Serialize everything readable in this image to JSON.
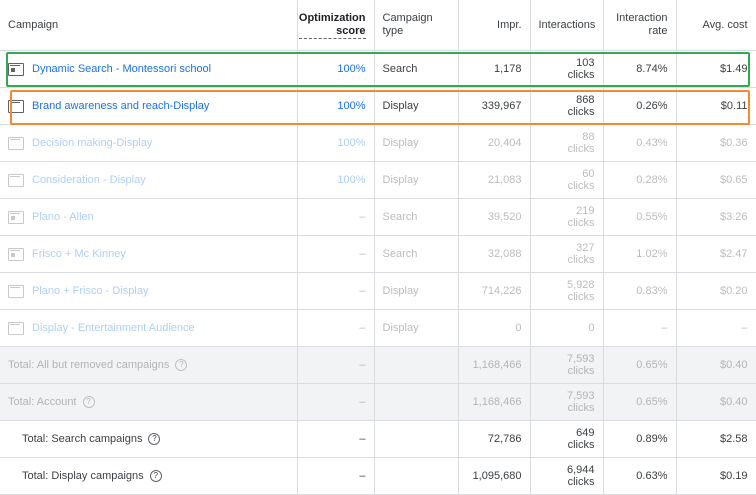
{
  "header": {
    "campaign": "Campaign",
    "optimization": "Optimization score",
    "campaign_type": "Campaign type",
    "impr": "Impr.",
    "interactions": "Interactions",
    "interaction_rate": "Interaction rate",
    "avg_cost": "Avg. cost"
  },
  "rows": [
    {
      "name": "Dynamic Search - Montessori school",
      "score": "100%",
      "type": "Search",
      "impr": "1,178",
      "inter": "103",
      "unit": "clicks",
      "rate": "8.74%",
      "cost": "$1.49",
      "icon": "search-campaign-icon"
    },
    {
      "name": "Brand awareness and reach-Display",
      "score": "100%",
      "type": "Display",
      "impr": "339,967",
      "inter": "868",
      "unit": "clicks",
      "rate": "0.26%",
      "cost": "$0.11",
      "icon": "display-campaign-icon"
    },
    {
      "name": "Decision making-Display",
      "score": "100%",
      "type": "Display",
      "impr": "20,404",
      "inter": "88",
      "unit": "clicks",
      "rate": "0.43%",
      "cost": "$0.36",
      "icon": "display-campaign-icon"
    },
    {
      "name": "Consideration - Display",
      "score": "100%",
      "type": "Display",
      "impr": "21,083",
      "inter": "60",
      "unit": "clicks",
      "rate": "0.28%",
      "cost": "$0.65",
      "icon": "display-campaign-icon"
    },
    {
      "name": "Plano - Allen",
      "score": "–",
      "type": "Search",
      "impr": "39,520",
      "inter": "219",
      "unit": "clicks",
      "rate": "0.55%",
      "cost": "$3.26",
      "icon": "search-campaign-icon"
    },
    {
      "name": "Frisco + Mc Kinney",
      "score": "–",
      "type": "Search",
      "impr": "32,088",
      "inter": "327",
      "unit": "clicks",
      "rate": "1.02%",
      "cost": "$2.47",
      "icon": "search-campaign-icon"
    },
    {
      "name": "Plano + Frisco - Display",
      "score": "–",
      "type": "Display",
      "impr": "714,226",
      "inter": "5,928",
      "unit": "clicks",
      "rate": "0.83%",
      "cost": "$0.20",
      "icon": "display-campaign-icon"
    },
    {
      "name": "Display - Entertainment Audience",
      "score": "–",
      "type": "Display",
      "impr": "0",
      "inter": "0",
      "unit": "",
      "rate": "–",
      "cost": "–",
      "icon": "display-campaign-icon"
    }
  ],
  "totals": [
    {
      "label": "Total: All but removed campaigns",
      "score": "–",
      "impr": "1,168,466",
      "inter": "7,593",
      "unit": "clicks",
      "rate": "0.65%",
      "cost": "$0.40"
    },
    {
      "label": "Total: Account",
      "score": "–",
      "impr": "1,168,466",
      "inter": "7,593",
      "unit": "clicks",
      "rate": "0.65%",
      "cost": "$0.40"
    },
    {
      "label": "Total: Search campaigns",
      "score": "–",
      "impr": "72,786",
      "inter": "649",
      "unit": "clicks",
      "rate": "0.89%",
      "cost": "$2.58"
    },
    {
      "label": "Total: Display campaigns",
      "score": "–",
      "impr": "1,095,680",
      "inter": "6,944",
      "unit": "clicks",
      "rate": "0.63%",
      "cost": "$0.19"
    }
  ],
  "icons": {
    "sort": "arrow-down-icon",
    "help": "help-circle-icon"
  },
  "colors": {
    "link": "#1a73e8",
    "highlight_green": "#34a853",
    "highlight_orange": "#f28b30"
  }
}
